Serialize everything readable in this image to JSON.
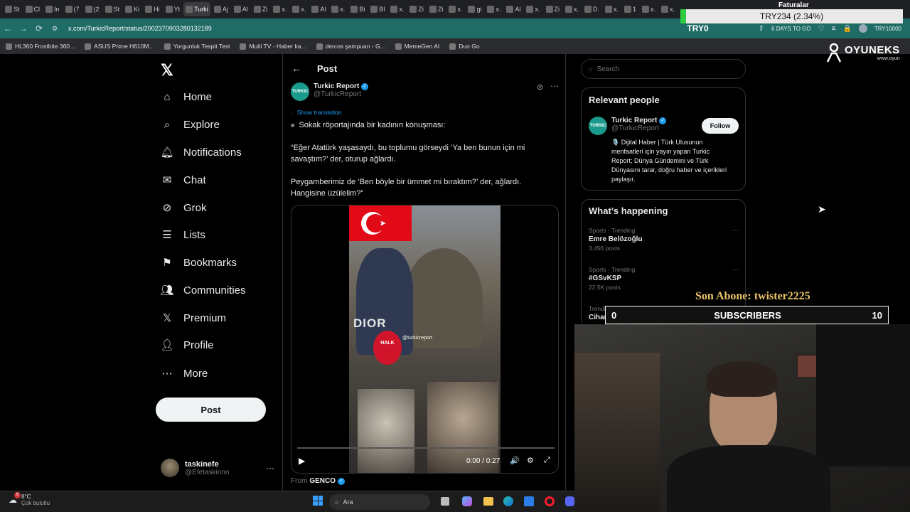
{
  "browser": {
    "tabs": [
      "St",
      "Cl",
      "In",
      "(7",
      "(2",
      "St",
      "Ki",
      "Hi",
      "Yt",
      "Turki",
      "Aj",
      "Al",
      "Zi",
      "x.",
      "x.",
      "Al",
      "x.",
      "Bi",
      "Bl",
      "x.",
      "Zi",
      "Zi",
      "x.",
      "gi",
      "x.",
      "Al",
      "x.",
      "Zi",
      "x.",
      "D.",
      "x.",
      "1",
      "x.",
      "x."
    ],
    "active_tab_index": 9,
    "url": "x.com/TurkicReport/status/2002370903280132189",
    "bookmarks": [
      "HL360 Frostbite 360...",
      "ASUS Prime H610M...",
      "Yorgunluk Tespit Test",
      "Multi TV - Haber ka...",
      "dercos şampuan - G...",
      "MemeGen AI",
      "Duo Go"
    ]
  },
  "nav": {
    "items": [
      {
        "label": "Home",
        "icon": "home-icon"
      },
      {
        "label": "Explore",
        "icon": "search-icon"
      },
      {
        "label": "Notifications",
        "icon": "bell-icon"
      },
      {
        "label": "Chat",
        "icon": "mail-icon"
      },
      {
        "label": "Grok",
        "icon": "grok-icon"
      },
      {
        "label": "Lists",
        "icon": "list-icon"
      },
      {
        "label": "Bookmarks",
        "icon": "bookmark-icon"
      },
      {
        "label": "Communities",
        "icon": "people-icon"
      },
      {
        "label": "Premium",
        "icon": "x-icon"
      },
      {
        "label": "Profile",
        "icon": "person-icon"
      },
      {
        "label": "More",
        "icon": "more-icon"
      }
    ],
    "post_button": "Post",
    "account": {
      "name": "taskinefe",
      "handle": "@Efetaskinnn"
    }
  },
  "post": {
    "header_title": "Post",
    "author_name": "Turkic Report",
    "author_handle": "@TurkicReport",
    "show_translation": "Show translation",
    "lines": [
      "Sokak röportajında bir kadının konuşması:",
      "“Eğer Atatürk yaşasaydı, bu toplumu görseydi ‘Ya ben bunun için mi savaştım?’ der, oturup ağlardı.",
      "Peygamberimiz de ‘Ben böyle bir ümmet mi bıraktım?’ der, ağlardı. Hangisine üzülelim?”"
    ],
    "video_time": "0:00 / 0:27",
    "video_progress": 0.0,
    "from_label": "From",
    "from_name": "GENCO",
    "video_overlay_texts": [
      "DIOR",
      "HALK",
      "@turkicreport"
    ]
  },
  "right": {
    "search_placeholder": "Search",
    "relevant_title": "Relevant people",
    "person": {
      "name": "Turkic Report",
      "handle": "@TurkicReport",
      "follow": "Follow",
      "bio": "🎙️ Dijital Haber | Türk Ulusunun menfaatleri için yayın yapan Turkic Report; Dünya Gündemini ve Türk Dünyasını tarar, doğru haber ve içerikleri paylaşır."
    },
    "happening_title": "What’s happening",
    "trends": [
      {
        "meta": "Sports · Trending",
        "name": "Emre Belözoğlu",
        "posts": "3,456 posts"
      },
      {
        "meta": "Sports · Trending",
        "name": "#GSvKSP",
        "posts": "22.5K posts"
      },
      {
        "meta": "Trending in Turkey",
        "name": "Cihan Şensözlü",
        "posts": ""
      }
    ]
  },
  "stream": {
    "ticker_label": "Faturalar",
    "ticker_value": "TRY234 (2.34%)",
    "ticker_sub": "TRY0",
    "days": "6 DAYS TO GO",
    "currency_right": "TRY10000",
    "brand": "OYUNEKS",
    "brand_sub": "www.oyun",
    "last_sub": "Son Abone: twister2225",
    "subs_left": "0",
    "subs_label": "SUBSCRIBERS",
    "subs_right": "10"
  },
  "taskbar": {
    "weather_temp": "8°C",
    "weather_desc": "Çok bulutlu",
    "weather_badge": "6",
    "search": "Ara"
  },
  "colors": {
    "accent_blue": "#1d9bf0",
    "stream_gold": "#e9c46a",
    "browser_teal": "#1f6b66"
  }
}
